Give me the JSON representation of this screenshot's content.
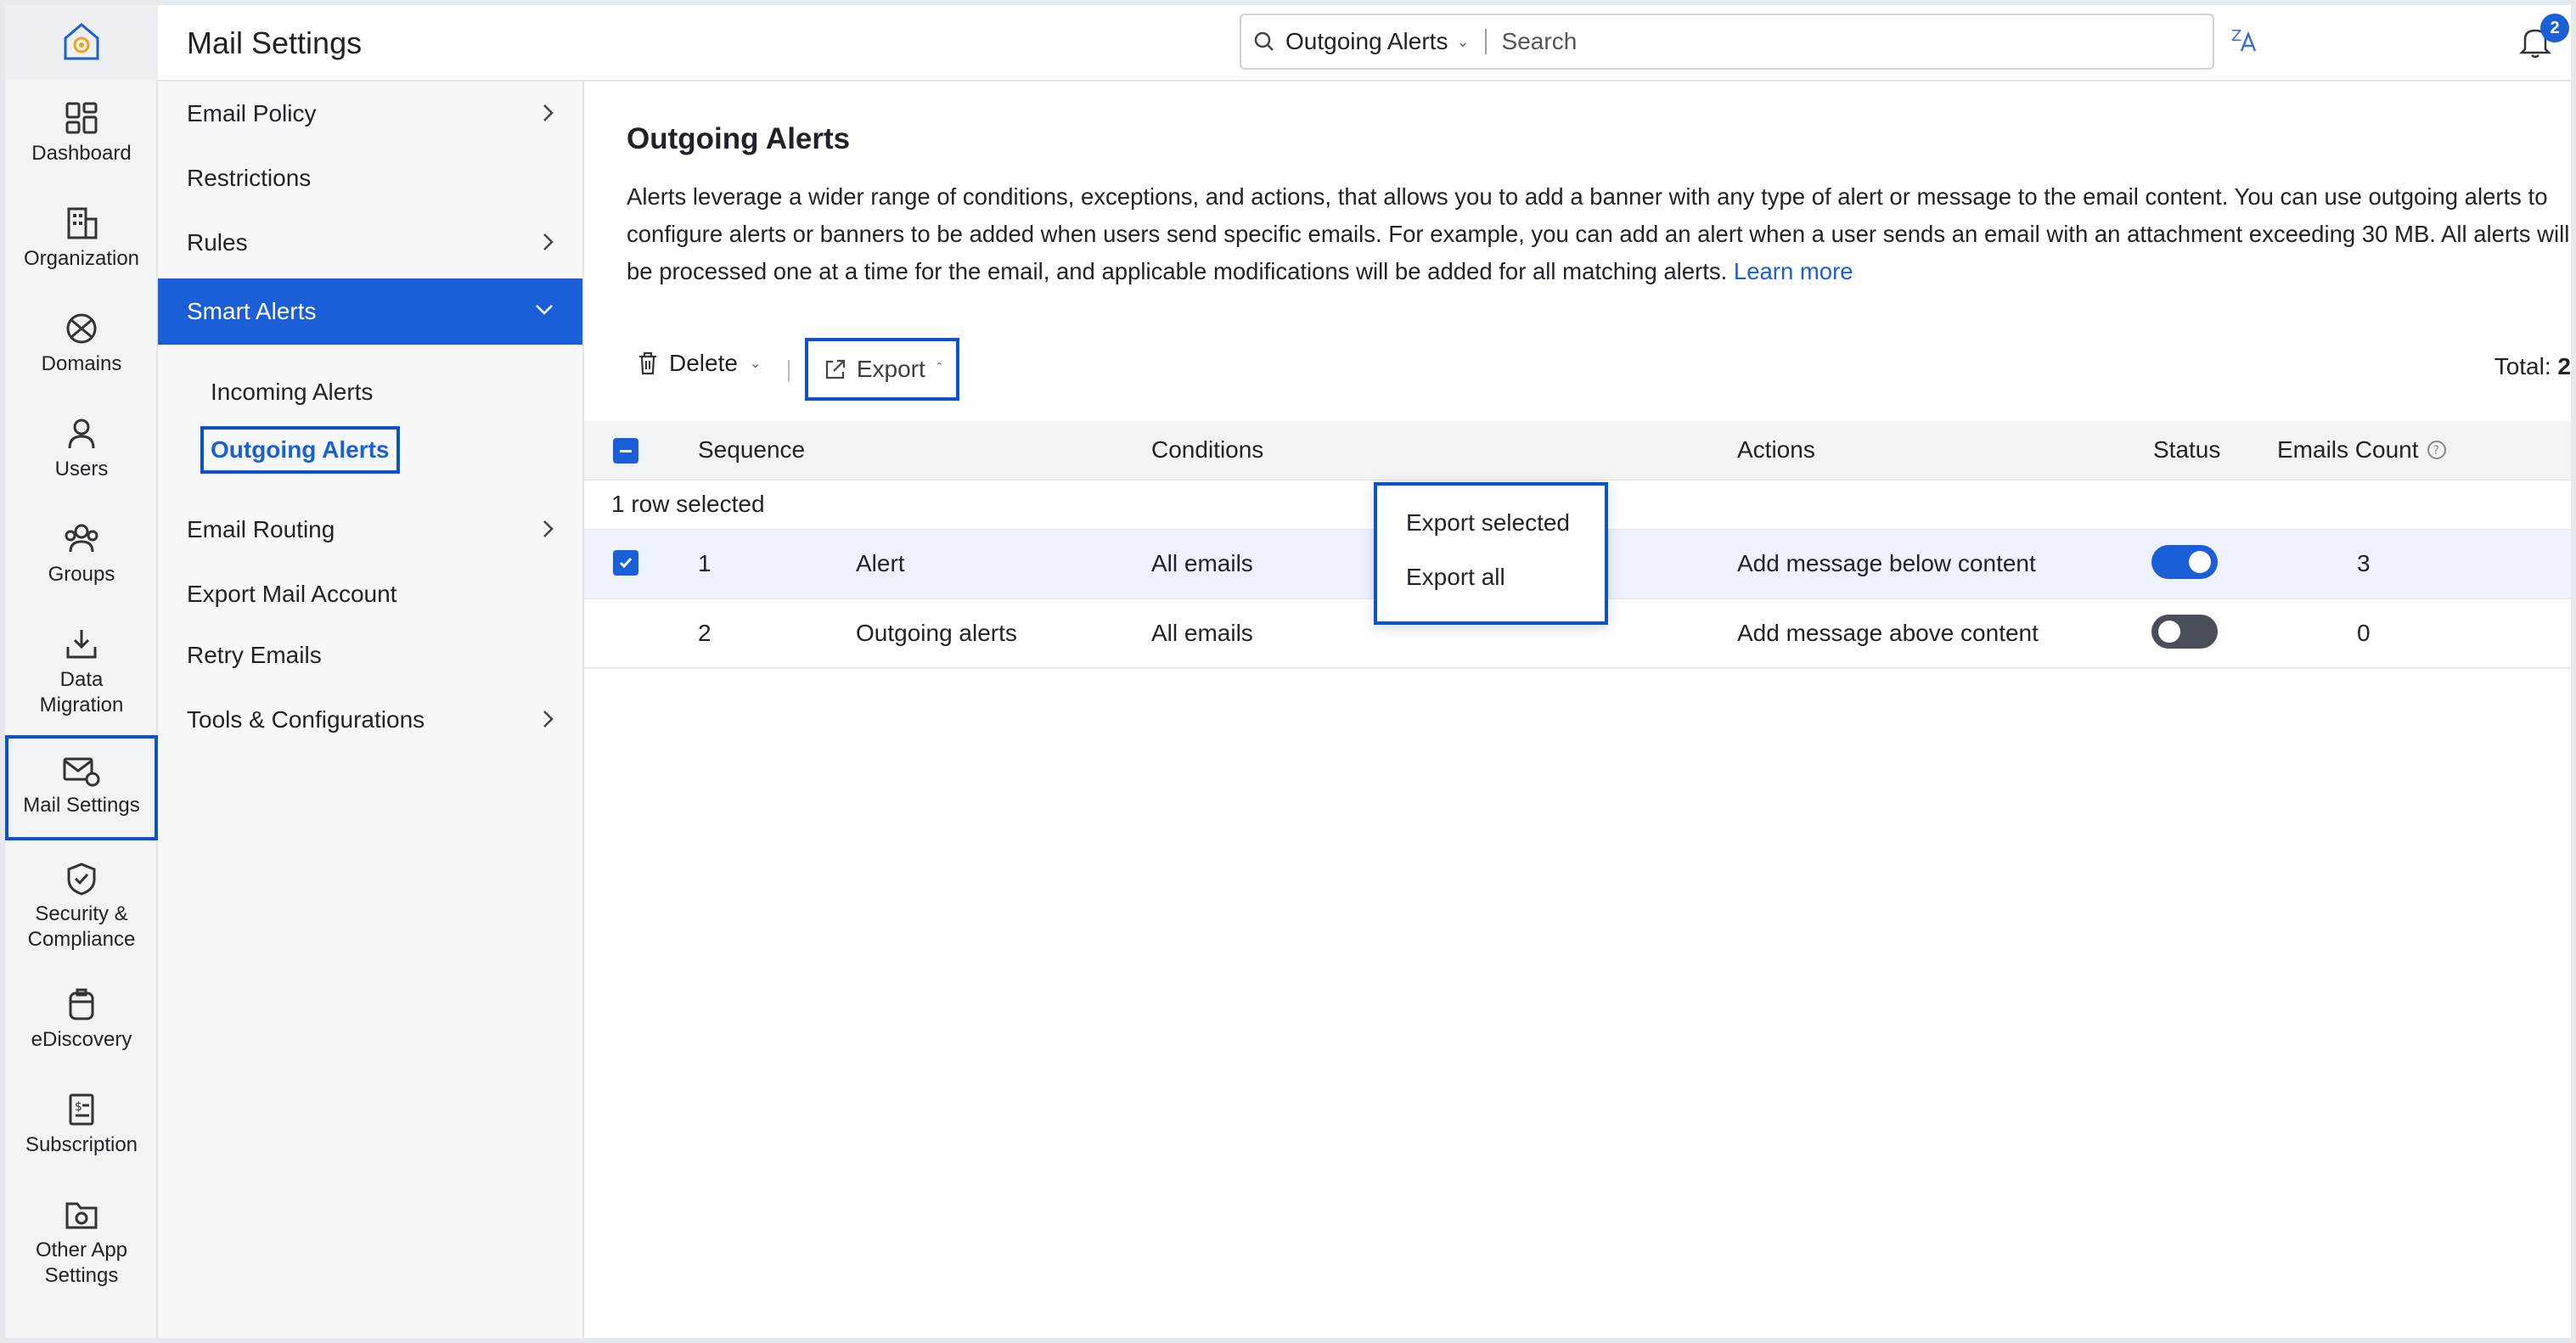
{
  "rail": {
    "items": [
      {
        "label": "Dashboard"
      },
      {
        "label": "Organization"
      },
      {
        "label": "Domains"
      },
      {
        "label": "Users"
      },
      {
        "label": "Groups"
      },
      {
        "label": "Data Migration"
      },
      {
        "label": "Mail Settings"
      },
      {
        "label": "Security & Compliance"
      },
      {
        "label": "eDiscovery"
      },
      {
        "label": "Subscription"
      },
      {
        "label": "Other App Settings"
      }
    ]
  },
  "header": {
    "title": "Mail Settings",
    "search_scope": "Outgoing Alerts",
    "search_placeholder": "Search",
    "notification_count": "2"
  },
  "subnav": {
    "items": [
      {
        "label": "Email Policy"
      },
      {
        "label": "Restrictions"
      },
      {
        "label": "Rules"
      },
      {
        "label": "Smart Alerts"
      },
      {
        "label": "Email Routing"
      },
      {
        "label": "Export Mail Account"
      },
      {
        "label": "Retry Emails"
      },
      {
        "label": "Tools & Configurations"
      }
    ],
    "smart_alerts_children": [
      {
        "label": "Incoming Alerts"
      },
      {
        "label": "Outgoing Alerts"
      }
    ]
  },
  "main": {
    "title": "Outgoing Alerts",
    "description": "Alerts leverage a wider range of conditions, exceptions, and actions, that allows you to add a banner with any type of alert or message to the email content. You can use outgoing alerts to configure alerts or banners to be added when users send specific emails. For example, you can add an alert when a user sends an email with an attachment exceeding 30 MB. All alerts will be processed one at a time for the email, and applicable modifications will be added for all matching alerts.",
    "learn_more": "Learn more",
    "toolbar": {
      "delete_label": "Delete",
      "export_label": "Export",
      "total_label": "Total:",
      "total_value": "2"
    },
    "export_menu": [
      "Export selected",
      "Export all"
    ],
    "table": {
      "columns": [
        "Sequence",
        "Conditions",
        "Actions",
        "Status",
        "Emails Count"
      ],
      "selection_text": "1 row selected",
      "rows": [
        {
          "sequence": "1",
          "name": "Alert",
          "conditions": "All emails",
          "actions": "Add message below content",
          "status_on": true,
          "emails_count": "3"
        },
        {
          "sequence": "2",
          "name": "Outgoing alerts",
          "conditions": "All emails",
          "actions": "Add message above content",
          "status_on": false,
          "emails_count": "0"
        }
      ]
    }
  },
  "colors": {
    "accent": "#1a5fd8",
    "highlight_border": "#0a54c8",
    "toggle_off": "#4a4f57"
  }
}
